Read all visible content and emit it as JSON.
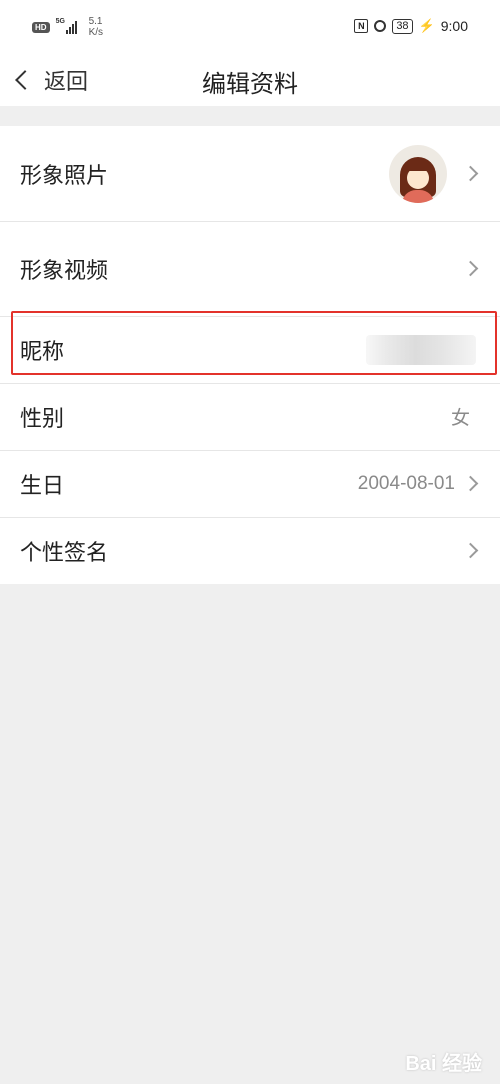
{
  "status_bar": {
    "hd": "HD",
    "network": "5G",
    "speed_value": "5.1",
    "speed_unit": "K/s",
    "nfc": "N",
    "battery": "38",
    "time": "9:00"
  },
  "nav": {
    "back_label": "返回",
    "title": "编辑资料"
  },
  "rows": [
    {
      "label": "形象照片",
      "value": "",
      "icon": "avatar-image"
    },
    {
      "label": "形象视频",
      "value": ""
    },
    {
      "label": "昵称",
      "value": ""
    },
    {
      "label": "性别",
      "value": "女"
    },
    {
      "label": "生日",
      "value": "2004-08-01"
    },
    {
      "label": "个性签名",
      "value": ""
    }
  ],
  "highlight_color": "#e3322b",
  "watermark": "Bai 经验"
}
